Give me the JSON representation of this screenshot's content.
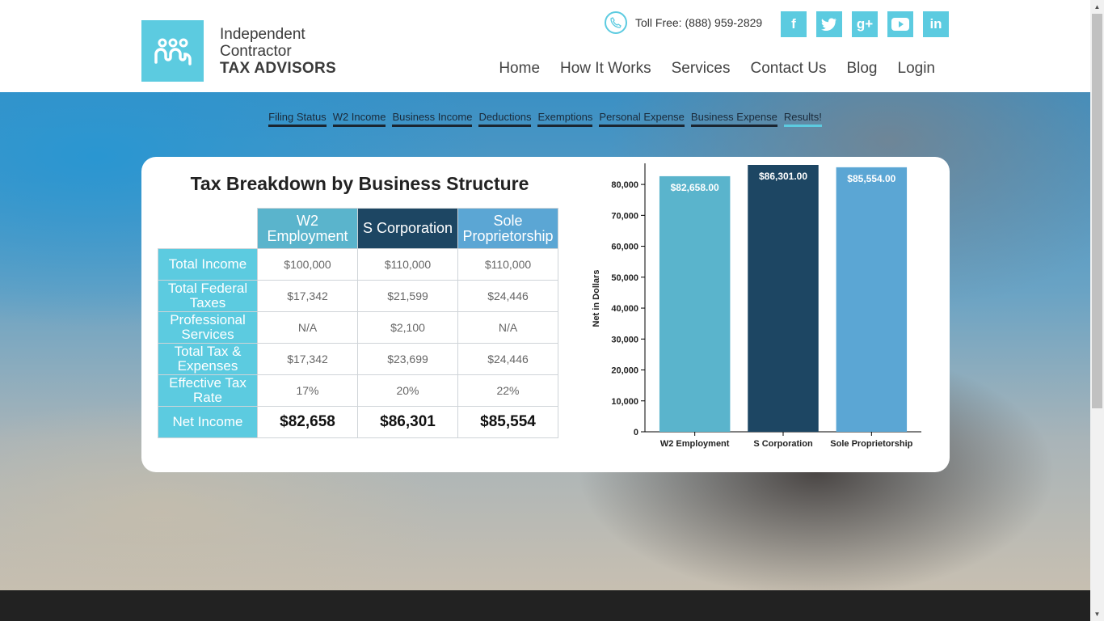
{
  "header": {
    "logo": {
      "line1": "Independent",
      "line2": "Contractor",
      "line3": "TAX ADVISORS"
    },
    "phone_text": "Toll Free: (888) 959-2829",
    "socials": [
      {
        "name": "facebook",
        "glyph": "f"
      },
      {
        "name": "twitter",
        "glyph": "t"
      },
      {
        "name": "google-plus",
        "glyph": "g+"
      },
      {
        "name": "youtube",
        "glyph": "▶"
      },
      {
        "name": "linkedin",
        "glyph": "in"
      }
    ],
    "nav": [
      "Home",
      "How It Works",
      "Services",
      "Contact Us",
      "Blog",
      "Login"
    ]
  },
  "steps": [
    "Filing Status",
    "W2 Income",
    "Business Income",
    "Deductions",
    "Exemptions",
    "Personal Expense",
    "Business Expense",
    "Results!"
  ],
  "card": {
    "title": "Tax Breakdown by Business Structure",
    "columns": [
      "W2 Employment",
      "S Corporation",
      "Sole Proprietorship"
    ],
    "rows": [
      {
        "label": "Total Income",
        "values": [
          "$100,000",
          "$110,000",
          "$110,000"
        ]
      },
      {
        "label": "Total Federal Taxes",
        "values": [
          "$17,342",
          "$21,599",
          "$24,446"
        ]
      },
      {
        "label": "Professional Services",
        "values": [
          "N/A",
          "$2,100",
          "N/A"
        ]
      },
      {
        "label": "Total Tax & Expenses",
        "values": [
          "$17,342",
          "$23,699",
          "$24,446"
        ]
      },
      {
        "label": "Effective Tax Rate",
        "values": [
          "17%",
          "20%",
          "22%"
        ]
      },
      {
        "label": "Net Income",
        "values": [
          "$82,658",
          "$86,301",
          "$85,554"
        ]
      }
    ]
  },
  "colors": {
    "accent": "#5ccbe0",
    "w2": "#5ab4cc",
    "scorp": "#1d4663",
    "sole": "#5ba6d4"
  },
  "chart_data": {
    "type": "bar",
    "categories": [
      "W2 Employment",
      "S Corporation",
      "Sole Proprietorship"
    ],
    "values": [
      82658,
      86301,
      85554
    ],
    "data_labels": [
      "$82,658.00",
      "$86,301.00",
      "$85,554.00"
    ],
    "ylabel": "Net in Dollars",
    "ylim": [
      0,
      86301
    ],
    "yticks": [
      0,
      10000,
      20000,
      30000,
      40000,
      50000,
      60000,
      70000,
      80000
    ],
    "ytick_labels": [
      "0",
      "10,000",
      "20,000",
      "30,000",
      "40,000",
      "50,000",
      "60,000",
      "70,000",
      "80,000"
    ],
    "bar_colors": [
      "#5ab4cc",
      "#1d4663",
      "#5ba6d4"
    ]
  }
}
